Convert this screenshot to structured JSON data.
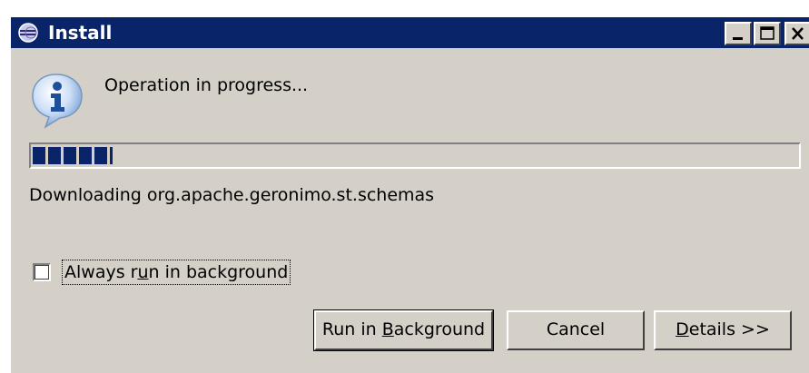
{
  "window": {
    "title": "Install",
    "controls": {
      "minimize_icon": "minimize-icon",
      "maximize_icon": "maximize-icon",
      "close_icon": "close-icon"
    }
  },
  "dialog": {
    "icon": "info-icon",
    "message": "Operation in progress...",
    "progress": {
      "fraction": 0.105,
      "style": "segmented"
    },
    "status": "Downloading org.apache.geronimo.st.schemas",
    "background_checkbox": {
      "checked": false,
      "label_pre": "Always r",
      "label_mnemonic": "u",
      "label_post": "n in background"
    }
  },
  "buttons": {
    "run_bg_pre": "Run in ",
    "run_bg_mnemonic": "B",
    "run_bg_post": "ackground",
    "cancel": "Cancel",
    "details_mnemonic": "D",
    "details_post": "etails >>"
  },
  "colors": {
    "titlebar": "#0a246a",
    "face": "#d4d0c8",
    "progress": "#0a246a"
  }
}
